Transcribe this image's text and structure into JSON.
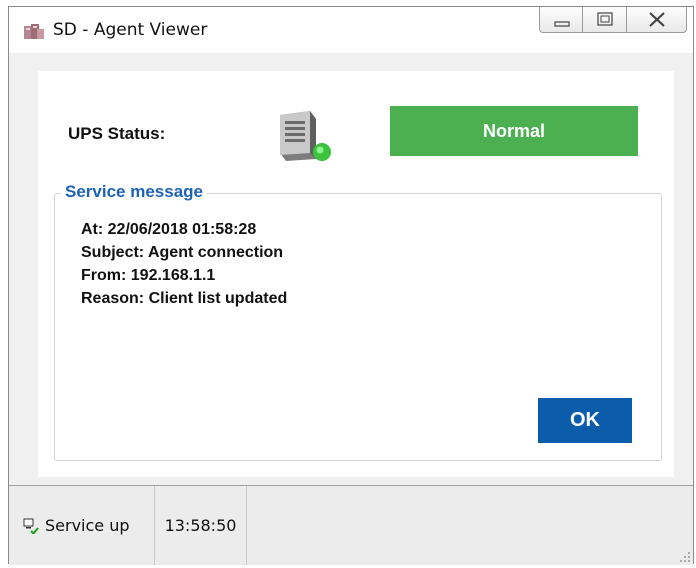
{
  "window": {
    "title": "SD - Agent Viewer",
    "app_icon": "app-icon",
    "controls": [
      "minimize-icon",
      "maximize-icon",
      "close-icon"
    ]
  },
  "ups": {
    "label": "UPS Status:",
    "icon": "server-icon",
    "status": "Normal",
    "status_color": "#4caf50"
  },
  "service_message": {
    "legend": "Service message",
    "lines": [
      "At: 22/06/2018 01:58:28",
      "Subject: Agent connection",
      "From: 192.168.1.1",
      "Reason: Client list updated"
    ]
  },
  "ok_label": "OK",
  "ok_color": "#0b5cab",
  "statusbar": {
    "service_icon": "network-connected-icon",
    "service": "Service up",
    "time": "13:58:50"
  }
}
